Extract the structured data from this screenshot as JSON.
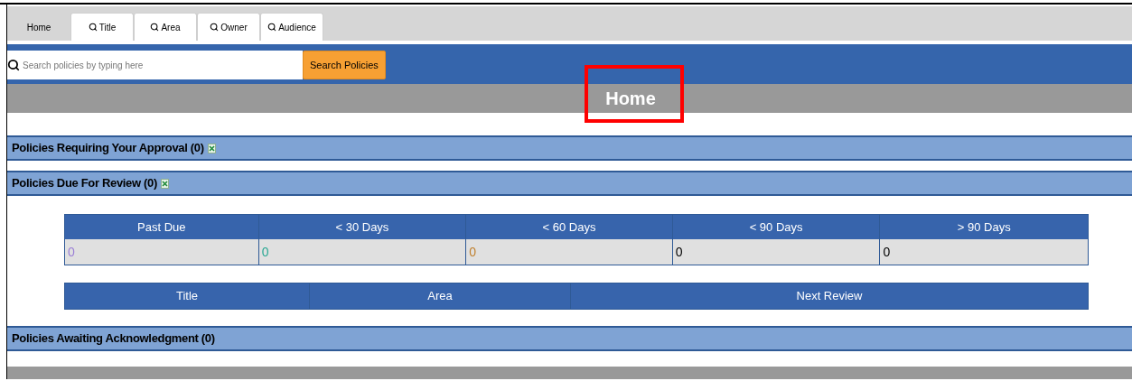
{
  "tabs": [
    {
      "label": "Home",
      "icon": false,
      "selected": true
    },
    {
      "label": "Title",
      "icon": true,
      "selected": false
    },
    {
      "label": "Area",
      "icon": true,
      "selected": false
    },
    {
      "label": "Owner",
      "icon": true,
      "selected": false
    },
    {
      "label": "Audience",
      "icon": true,
      "selected": false
    }
  ],
  "search": {
    "placeholder": "Search policies by typing here",
    "button": "Search Policies"
  },
  "page_title": {
    "text": "Home",
    "highlighted": true
  },
  "sections": [
    {
      "title": "Policies Requiring Your Approval (0)",
      "export_icon": true,
      "kind": "plain"
    },
    {
      "title": "Policies Due For Review (0)",
      "export_icon": true,
      "kind": "review",
      "summary_columns": [
        "Past Due",
        "< 30 Days",
        "< 60 Days",
        "< 90 Days",
        "> 90 Days"
      ],
      "summary_values": [
        {
          "text": "0",
          "color": "#9b7fd6"
        },
        {
          "text": "0",
          "color": "#2aa893"
        },
        {
          "text": "0",
          "color": "#c0802e"
        },
        {
          "text": "0",
          "color": "#000000"
        },
        {
          "text": "0",
          "color": "#000000"
        }
      ],
      "list_columns": [
        "Title",
        "Area",
        "Next Review"
      ]
    },
    {
      "title": "Policies Awaiting Acknowledgment (0)",
      "export_icon": false,
      "kind": "plain"
    }
  ]
}
